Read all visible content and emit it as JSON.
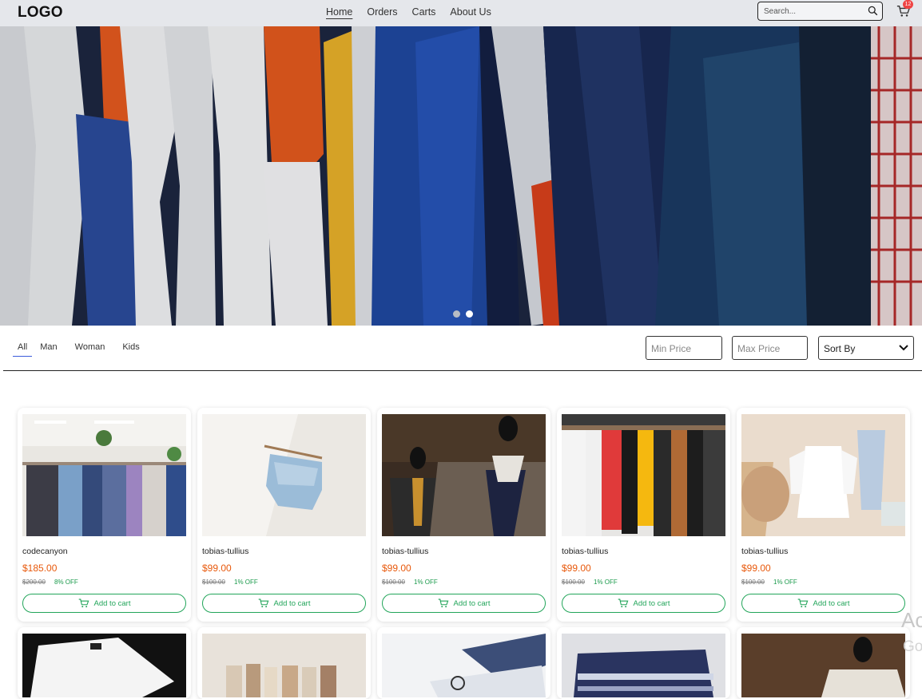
{
  "header": {
    "logo": "LOGO",
    "nav": [
      "Home",
      "Orders",
      "Carts",
      "About Us"
    ],
    "search_placeholder": "Search...",
    "cart_count": "12"
  },
  "hero": {
    "slides": 2,
    "active_slide": 2
  },
  "filters": {
    "tabs": [
      "All",
      "Man",
      "Woman",
      "Kids"
    ],
    "active_tab": "All",
    "min_price_placeholder": "Min Price",
    "max_price_placeholder": "Max Price",
    "sort_label": "Sort By"
  },
  "products": [
    {
      "name": "codecanyon",
      "price": "$185.00",
      "old_price": "$200.00",
      "discount": "8% OFF",
      "button": "Add to cart"
    },
    {
      "name": "tobias-tullius",
      "price": "$99.00",
      "old_price": "$100.00",
      "discount": "1% OFF",
      "button": "Add to cart"
    },
    {
      "name": "tobias-tullius",
      "price": "$99.00",
      "old_price": "$100.00",
      "discount": "1% OFF",
      "button": "Add to cart"
    },
    {
      "name": "tobias-tullius",
      "price": "$99.00",
      "old_price": "$100.00",
      "discount": "1% OFF",
      "button": "Add to cart"
    },
    {
      "name": "tobias-tullius",
      "price": "$99.00",
      "old_price": "$100.00",
      "discount": "1% OFF",
      "button": "Add to cart"
    }
  ],
  "colors": {
    "price": "#e8590c",
    "discount": "#1a9a4b",
    "button": "#22a55a",
    "header_bg": "#e5e7eb",
    "badge": "#ef4444"
  },
  "watermark": {
    "line1": "Ac",
    "line2": "Go"
  }
}
